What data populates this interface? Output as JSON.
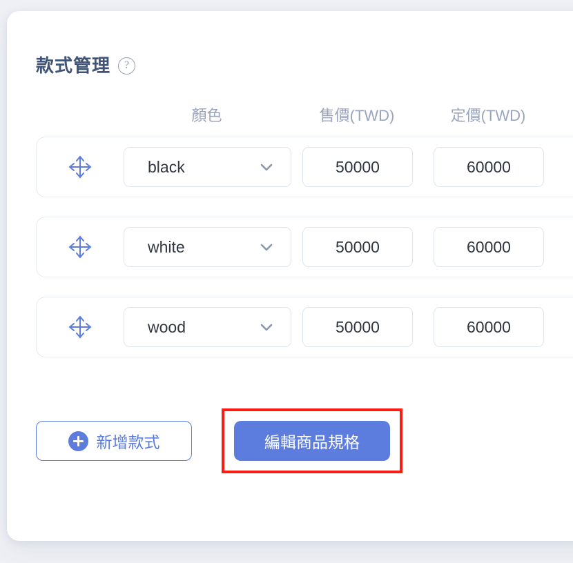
{
  "theme": {
    "page_background": "#eef0f5",
    "card_background": "#ffffff",
    "accent_blue": "#5c7cde",
    "title_color": "#3f5477",
    "muted_text": "#9ba4bd",
    "input_border": "#dfe5f1",
    "row_border": "#e4e9f3",
    "highlight_red": "#fb1d14"
  },
  "card": {
    "title": "款式管理",
    "help_icon": "question-mark-circle-icon",
    "help_label": "?"
  },
  "table": {
    "columns": [
      {
        "key": "handle",
        "label": ""
      },
      {
        "key": "color",
        "label": "顏色"
      },
      {
        "key": "price",
        "label": "售價(TWD)"
      },
      {
        "key": "list_price",
        "label": "定價(TWD)"
      }
    ],
    "rows": [
      {
        "handle_icon": "move-arrows-icon",
        "color": "black",
        "dropdown_icon": "chevron-down-icon",
        "price": "50000",
        "list_price": "60000"
      },
      {
        "handle_icon": "move-arrows-icon",
        "color": "white",
        "dropdown_icon": "chevron-down-icon",
        "price": "50000",
        "list_price": "60000"
      },
      {
        "handle_icon": "move-arrows-icon",
        "color": "wood",
        "dropdown_icon": "chevron-down-icon",
        "price": "50000",
        "list_price": "60000"
      }
    ]
  },
  "footer": {
    "add_variant": {
      "label": "新增款式",
      "icon": "plus-circle-icon"
    },
    "edit_spec": {
      "label": "編輯商品規格",
      "highlighted": true
    }
  }
}
